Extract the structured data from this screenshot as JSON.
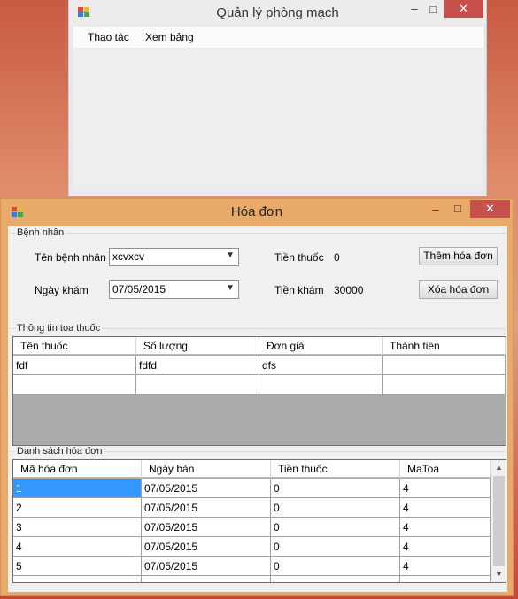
{
  "background_window": {
    "title": "Quản lý phòng mạch",
    "menu": [
      "Thao tác",
      "Xem bảng"
    ],
    "buttons": {
      "minimize": "▭",
      "maximize": "□",
      "close": "✕"
    }
  },
  "invoice_window": {
    "title": "Hóa đơn",
    "buttons": {
      "minimize": "–",
      "maximize": "□",
      "close": "✕"
    },
    "patient_group": {
      "label": "Bệnh nhân",
      "patient_name_label": "Tên bệnh nhân",
      "patient_name_value": "xcvxcv",
      "exam_date_label": "Ngày khám",
      "exam_date_value": "07/05/2015",
      "medicine_fee_label": "Tiền thuốc",
      "medicine_fee_value": "0",
      "exam_fee_label": "Tiền khám",
      "exam_fee_value": "30000",
      "add_invoice_button": "Thêm hóa đơn",
      "delete_invoice_button": "Xóa hóa đơn"
    },
    "prescription_group": {
      "label": "Thông tin toa thuốc",
      "columns": [
        "Tên thuốc",
        "Số lượng",
        "Đơn giá",
        "Thành tiền"
      ],
      "rows": [
        [
          "fdf",
          "fdfd",
          "dfs",
          ""
        ],
        [
          "",
          "",
          "",
          ""
        ]
      ]
    },
    "invoice_list_group": {
      "label": "Danh sách hóa đơn",
      "columns": [
        "Mã hóa đơn",
        "Ngày bán",
        "Tiền thuốc",
        "MaToa"
      ],
      "rows": [
        [
          "1",
          "07/05/2015",
          "0",
          "4"
        ],
        [
          "2",
          "07/05/2015",
          "0",
          "4"
        ],
        [
          "3",
          "07/05/2015",
          "0",
          "4"
        ],
        [
          "4",
          "07/05/2015",
          "0",
          "4"
        ],
        [
          "5",
          "07/05/2015",
          "0",
          "4"
        ]
      ],
      "selected_row": 0
    }
  },
  "colors": {
    "title_active": "#e9a968",
    "close_button": "#c7504c",
    "selection": "#3399ff",
    "grid_background": "#ababab"
  }
}
